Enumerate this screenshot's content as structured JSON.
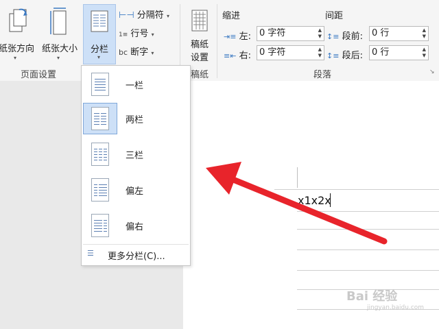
{
  "ribbon": {
    "orientation_label": "纸张方向",
    "size_label": "纸张大小",
    "columns_label": "分栏",
    "breaks_label": "分隔符",
    "line_numbers_label": "行号",
    "hyphenation_label": "断字",
    "page_setup_group": "页面设置",
    "draft_label_line1": "稿纸",
    "draft_label_line2": "设置",
    "draft_group": "稿纸",
    "indent_header": "缩进",
    "spacing_header": "间距",
    "indent_left_label": "左:",
    "indent_left_value": "0 字符",
    "indent_right_label": "右:",
    "indent_right_value": "0 字符",
    "space_before_label": "段前:",
    "space_before_value": "0 行",
    "space_after_label": "段后:",
    "space_after_value": "0 行",
    "paragraph_group": "段落"
  },
  "columns_menu": {
    "items": [
      {
        "label": "一栏"
      },
      {
        "label": "两栏"
      },
      {
        "label": "三栏"
      },
      {
        "label": "偏左"
      },
      {
        "label": "偏右"
      }
    ],
    "more_label": "更多分栏(C)..."
  },
  "document": {
    "text": "x1x2x"
  },
  "watermark": {
    "main": "Bai 经验",
    "sub": "jingyan.baidu.com"
  },
  "colors": {
    "arrow": "#e8242b",
    "selected_bg": "#cde0f7",
    "selected_border": "#7fa7d9"
  }
}
